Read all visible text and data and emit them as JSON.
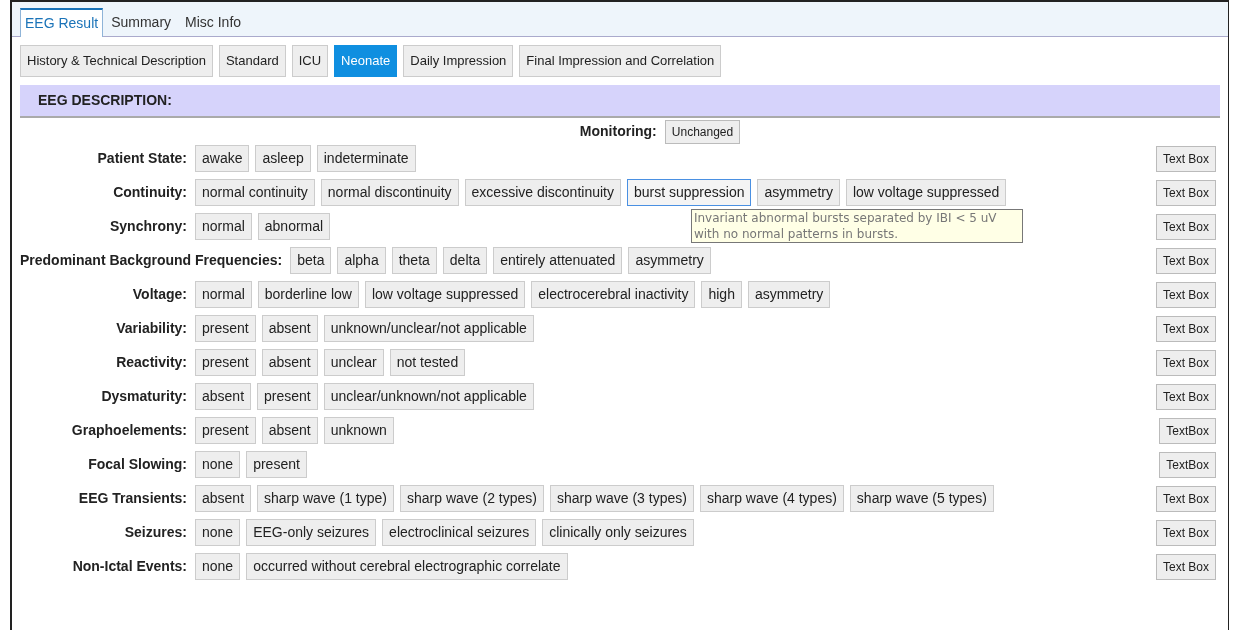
{
  "tabs": [
    {
      "label": "EEG Result",
      "selected": true
    },
    {
      "label": "Summary",
      "selected": false
    },
    {
      "label": "Misc Info",
      "selected": false
    }
  ],
  "subtabs": [
    {
      "label": "History & Technical Description",
      "selected": false
    },
    {
      "label": "Standard",
      "selected": false
    },
    {
      "label": "ICU",
      "selected": false
    },
    {
      "label": "Neonate",
      "selected": true
    },
    {
      "label": "Daily Impression",
      "selected": false
    },
    {
      "label": "Final Impression and Correlation",
      "selected": false
    }
  ],
  "section_title": "EEG DESCRIPTION:",
  "monitoring": {
    "label": "Monitoring:",
    "button": "Unchanged"
  },
  "rows": [
    {
      "label": "Patient State:",
      "options": [
        {
          "label": "awake",
          "focused": false
        },
        {
          "label": "asleep",
          "focused": false
        },
        {
          "label": "indeterminate",
          "focused": false
        }
      ],
      "text_box": "Text Box"
    },
    {
      "label": "Continuity:",
      "options": [
        {
          "label": "normal continuity",
          "focused": false
        },
        {
          "label": "normal discontinuity",
          "focused": false
        },
        {
          "label": "excessive discontinuity",
          "focused": false
        },
        {
          "label": "burst suppression",
          "focused": true
        },
        {
          "label": "asymmetry",
          "focused": false
        },
        {
          "label": "low voltage suppressed",
          "focused": false
        }
      ],
      "text_box": "Text Box",
      "tooltip": "Invariant abnormal bursts separated by IBI < 5 uV with no normal patterns in bursts."
    },
    {
      "label": "Synchrony:",
      "options": [
        {
          "label": "normal",
          "focused": false
        },
        {
          "label": "abnormal",
          "focused": false
        }
      ],
      "text_box": "Text Box"
    },
    {
      "label": "Predominant Background Frequencies:",
      "options": [
        {
          "label": "beta",
          "focused": false
        },
        {
          "label": "alpha",
          "focused": false
        },
        {
          "label": "theta",
          "focused": false
        },
        {
          "label": "delta",
          "focused": false
        },
        {
          "label": "entirely attenuated",
          "focused": false
        },
        {
          "label": "asymmetry",
          "focused": false
        }
      ],
      "text_box": "Text Box"
    },
    {
      "label": "Voltage:",
      "options": [
        {
          "label": "normal",
          "focused": false
        },
        {
          "label": "borderline low",
          "focused": false
        },
        {
          "label": "low voltage suppressed",
          "focused": false
        },
        {
          "label": "electrocerebral inactivity",
          "focused": false
        },
        {
          "label": "high",
          "focused": false
        },
        {
          "label": "asymmetry",
          "focused": false
        }
      ],
      "text_box": "Text Box"
    },
    {
      "label": "Variability:",
      "options": [
        {
          "label": "present",
          "focused": false
        },
        {
          "label": "absent",
          "focused": false
        },
        {
          "label": "unknown/unclear/not applicable",
          "focused": false
        }
      ],
      "text_box": "Text Box"
    },
    {
      "label": "Reactivity:",
      "options": [
        {
          "label": "present",
          "focused": false
        },
        {
          "label": "absent",
          "focused": false
        },
        {
          "label": "unclear",
          "focused": false
        },
        {
          "label": "not tested",
          "focused": false
        }
      ],
      "text_box": "Text Box"
    },
    {
      "label": "Dysmaturity:",
      "options": [
        {
          "label": "absent",
          "focused": false
        },
        {
          "label": "present",
          "focused": false
        },
        {
          "label": "unclear/unknown/not applicable",
          "focused": false
        }
      ],
      "text_box": "Text Box"
    },
    {
      "label": "Graphoelements:",
      "options": [
        {
          "label": "present",
          "focused": false
        },
        {
          "label": "absent",
          "focused": false
        },
        {
          "label": "unknown",
          "focused": false
        }
      ],
      "text_box": "TextBox"
    },
    {
      "label": "Focal Slowing:",
      "options": [
        {
          "label": "none",
          "focused": false
        },
        {
          "label": "present",
          "focused": false
        }
      ],
      "text_box": "TextBox"
    },
    {
      "label": "EEG Transients:",
      "options": [
        {
          "label": "absent",
          "focused": false
        },
        {
          "label": "sharp wave (1 type)",
          "focused": false
        },
        {
          "label": "sharp wave (2 types)",
          "focused": false
        },
        {
          "label": "sharp wave (3 types)",
          "focused": false
        },
        {
          "label": "sharp wave (4 types)",
          "focused": false
        },
        {
          "label": "sharp wave (5 types)",
          "focused": false
        }
      ],
      "text_box": "Text Box"
    },
    {
      "label": "Seizures:",
      "options": [
        {
          "label": "none",
          "focused": false
        },
        {
          "label": "EEG-only seizures",
          "focused": false
        },
        {
          "label": "electroclinical seizures",
          "focused": false
        },
        {
          "label": "clinically only seizures",
          "focused": false
        }
      ],
      "text_box": "Text Box"
    },
    {
      "label": "Non-Ictal Events:",
      "options": [
        {
          "label": "none",
          "focused": false
        },
        {
          "label": "occurred without cerebral electrographic correlate",
          "focused": false
        }
      ],
      "text_box": "Text Box"
    }
  ]
}
